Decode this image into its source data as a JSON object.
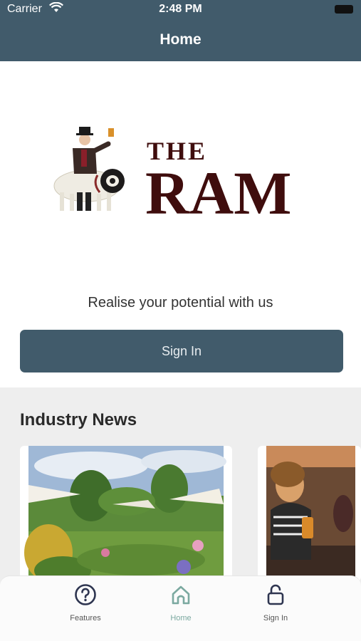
{
  "status_bar": {
    "carrier": "Carrier",
    "time": "2:48 PM"
  },
  "nav": {
    "title": "Home"
  },
  "logo": {
    "line1": "THE",
    "line2": "RAM"
  },
  "hero": {
    "tagline": "Realise your potential with us",
    "signin_label": "Sign In"
  },
  "news": {
    "title": "Industry News"
  },
  "tabs": [
    {
      "label": "Features",
      "icon": "question-circle-icon",
      "active": false
    },
    {
      "label": "Home",
      "icon": "home-icon",
      "active": true
    },
    {
      "label": "Sign In",
      "icon": "lock-icon",
      "active": false
    }
  ],
  "colors": {
    "primary": "#415b6b",
    "logo_text": "#3f0d0d",
    "active_tab": "#7ba9a0",
    "section_bg": "#eeeeee"
  }
}
